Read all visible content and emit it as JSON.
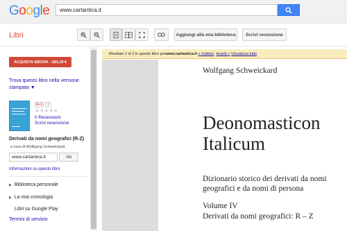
{
  "header": {
    "logo_letters": [
      "G",
      "o",
      "o",
      "g",
      "l",
      "e"
    ],
    "search_value": "www.cartantica.it",
    "search_icon": "magnifier-icon"
  },
  "toolbar": {
    "section_label": "Libri",
    "zoom_in_icon": "zoom-in-icon",
    "zoom_out_icon": "zoom-out-icon",
    "single_page_icon": "single-page-icon",
    "two_page_icon": "two-page-icon",
    "fullscreen_icon": "fullscreen-icon",
    "link_icon": "link-icon",
    "add_library_label": "Aggiungi alla mia biblioteca",
    "write_review_label": "Scrivi recensione"
  },
  "sidebar": {
    "buy_label": "ACQUISTA EBOOK - 283,19 €",
    "find_label": "Trova questo libro nella versione stampata ▼",
    "gplus_label": "G+1",
    "gplus_count": "1",
    "stars": "★★★★★",
    "reviews_label": "0 Recensioni",
    "write_label": "Scrivi recensione",
    "book_title": "Derivati da nomi geografici (R-Z)",
    "book_author": "a cura di Wolfgang Schweickard",
    "site_value": "www.cartantica.it",
    "go_label": "Vai",
    "info_label": "Informazioni su questo libro",
    "menu": [
      "Biblioteca personale",
      "La mia cronologia",
      "Libri su Google Play"
    ],
    "terms_label": "Termini di servizio"
  },
  "banner": {
    "prefix": "Risultato 2 di 2 in questo libro per ",
    "query": "www.cartantica.it",
    "sep": " - ",
    "prev_label": "« Indietro",
    "next_label": "Avanti »",
    "view_all_label": "Visualizza tutto"
  },
  "page": {
    "author": "Wolfgang Schweickard",
    "title_line1": "Deonomasticon",
    "title_line2": "Italicum",
    "subtitle_line1": "Dizionario storico dei derivati da nomi",
    "subtitle_line2": "geografici e da nomi di persona",
    "volume_line1": "Volume IV",
    "volume_line2": "Derivati da nomi geografici: R – Z"
  },
  "colors": {
    "buy_button": "#d14836",
    "search_button": "#4285f4",
    "libri_red": "#dd4b39",
    "banner_yellow": "#f9edbe",
    "link_blue": "#1a0dab"
  }
}
